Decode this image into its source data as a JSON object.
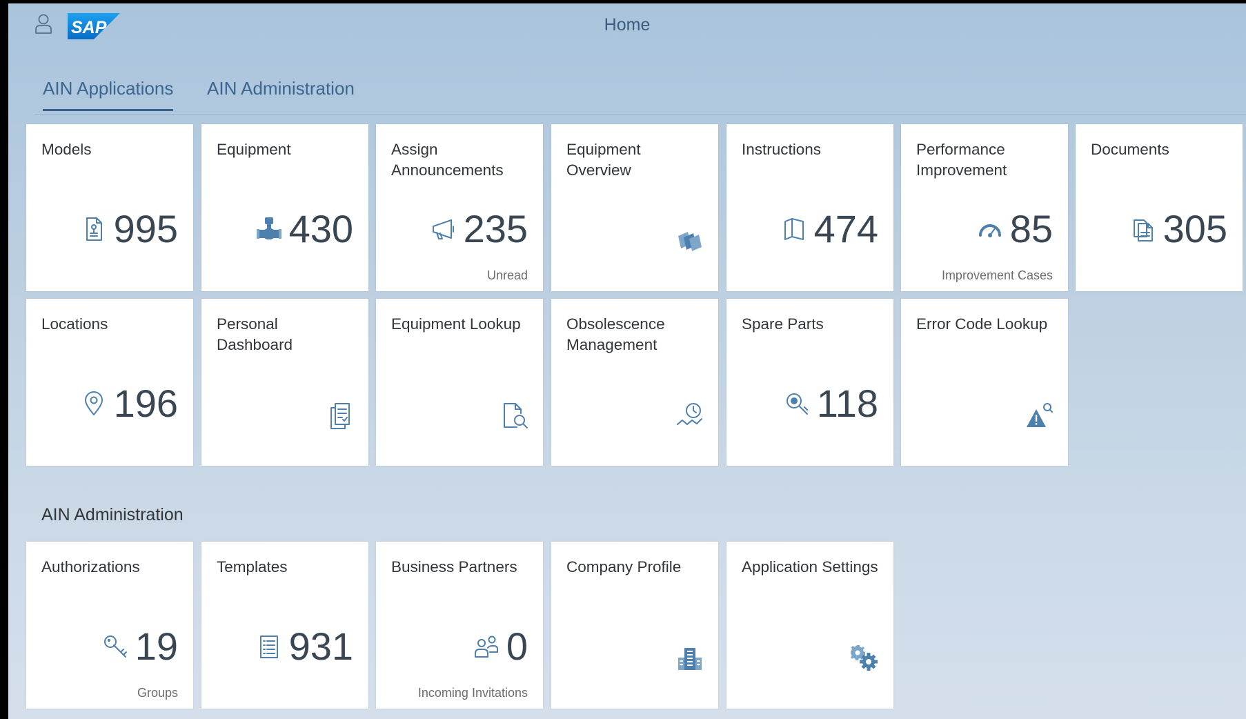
{
  "header": {
    "title": "Home",
    "logo_text": "SAP",
    "user_icon": "user-icon"
  },
  "tabs": [
    {
      "label": "AIN Applications",
      "active": true
    },
    {
      "label": "AIN Administration",
      "active": false
    }
  ],
  "groups": {
    "applications": {
      "tiles": [
        {
          "title": "Models",
          "value": "995",
          "icon": "product-document-icon"
        },
        {
          "title": "Equipment",
          "value": "430",
          "icon": "valve-equipment-icon"
        },
        {
          "title": "Assign Announcements",
          "value": "235",
          "footer": "Unread",
          "icon": "megaphone-icon"
        },
        {
          "title": "Equipment Overview",
          "icon": "stacked-panels-icon"
        },
        {
          "title": "Instructions",
          "value": "474",
          "icon": "open-book-icon"
        },
        {
          "title": "Performance Improvement",
          "value": "85",
          "footer": "Improvement Cases",
          "icon": "speedometer-icon"
        },
        {
          "title": "Documents",
          "value": "305",
          "icon": "documents-icon"
        },
        {
          "title": "Locations",
          "value": "196",
          "icon": "location-pin-icon"
        },
        {
          "title": "Personal Dashboard",
          "icon": "checklist-document-icon"
        },
        {
          "title": "Equipment Lookup",
          "icon": "document-search-icon"
        },
        {
          "title": "Obsolescence Management",
          "icon": "clock-trend-icon"
        },
        {
          "title": "Spare Parts",
          "value": "118",
          "icon": "search-parts-icon"
        },
        {
          "title": "Error Code Lookup",
          "icon": "warning-search-icon"
        }
      ]
    },
    "administration": {
      "title": "AIN Administration",
      "tiles": [
        {
          "title": "Authorizations",
          "value": "19",
          "footer": "Groups",
          "icon": "key-icon"
        },
        {
          "title": "Templates",
          "value": "931",
          "icon": "list-document-icon"
        },
        {
          "title": "Business Partners",
          "value": "0",
          "footer": "Incoming Invitations",
          "icon": "business-partners-icon"
        },
        {
          "title": "Company Profile",
          "icon": "building-icon"
        },
        {
          "title": "Application Settings",
          "icon": "gears-icon"
        }
      ]
    }
  },
  "colors": {
    "icon": "#4d80ad",
    "kpi": "#3a4652",
    "tab_active": "#346187",
    "logo_blue": "#1a8de0"
  }
}
